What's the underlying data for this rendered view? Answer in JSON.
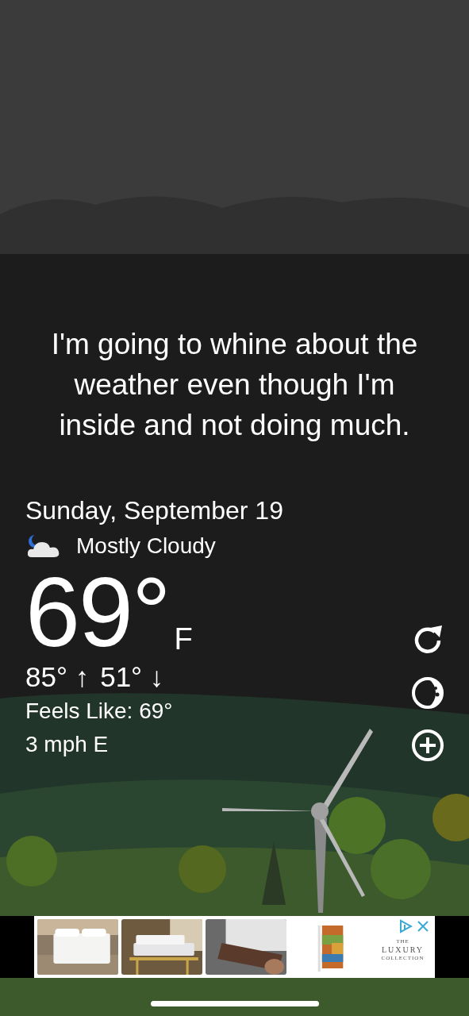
{
  "quote": "I'm going to whine about the weather even though I'm inside and not doing much.",
  "date": "Sunday, September 19",
  "condition": "Mostly Cloudy",
  "temperature": "69°",
  "unit": "F",
  "high": {
    "value": "85°",
    "arrow": "↑"
  },
  "low": {
    "value": "51°",
    "arrow": "↓"
  },
  "feels_like": "Feels Like: 69°",
  "wind": "3 mph E",
  "actions": [
    {
      "kind": "refresh"
    },
    {
      "kind": "moon"
    },
    {
      "kind": "add"
    }
  ],
  "ad": {
    "images": [
      {
        "kind": "picture"
      },
      {
        "kind": "picture"
      },
      {
        "kind": "picture"
      },
      {
        "kind": "picture"
      }
    ],
    "logo": [
      "THE",
      "LUXURY",
      "COLLECTION"
    ]
  }
}
